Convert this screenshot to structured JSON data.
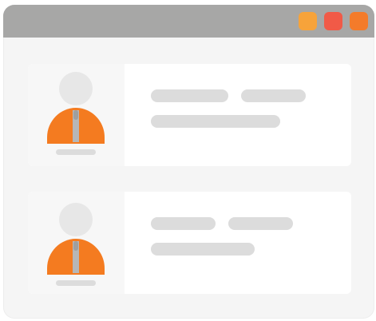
{
  "window": {
    "titlebar_color": "#a7a7a6",
    "controls": [
      {
        "name": "window-control-yellow",
        "color": "#f7a33a"
      },
      {
        "name": "window-control-red",
        "color": "#f15a47"
      },
      {
        "name": "window-control-orange",
        "color": "#f47b2a"
      }
    ]
  },
  "theme": {
    "avatar_head_color": "#e7e7e7",
    "avatar_body_color": "#f47b20",
    "avatar_tie_color": "#b7b7b7",
    "placeholder_line_color": "#dcdcdc",
    "card_color": "#ffffff",
    "avatar_panel_color": "#f7f7f7"
  },
  "cards": [
    {
      "avatar_icon": "user-icon"
    },
    {
      "avatar_icon": "user-icon"
    }
  ]
}
